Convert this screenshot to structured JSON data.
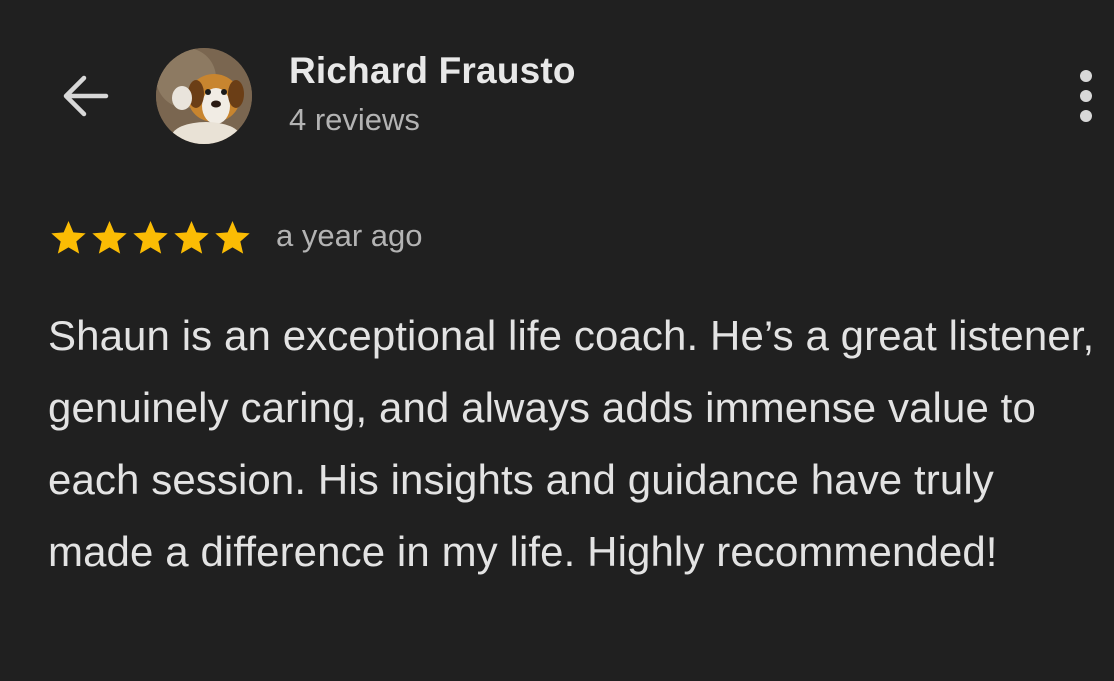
{
  "header": {
    "reviewer_name": "Richard Frausto",
    "review_count": "4 reviews",
    "back_icon": "arrow-left-icon",
    "menu_icon": "more-vertical-icon"
  },
  "review": {
    "rating": 5,
    "rating_max": 5,
    "date": "a year ago",
    "text": "Shaun is an exceptional life coach. He’s a great listener, genuinely caring, and always adds immense value to each session. His insights and guidance have truly made a difference in my life. Highly recommended!"
  },
  "colors": {
    "background": "#202020",
    "star": "#FBBC04",
    "primary_text": "#E3E3E3",
    "secondary_text": "#B3B3B3"
  }
}
